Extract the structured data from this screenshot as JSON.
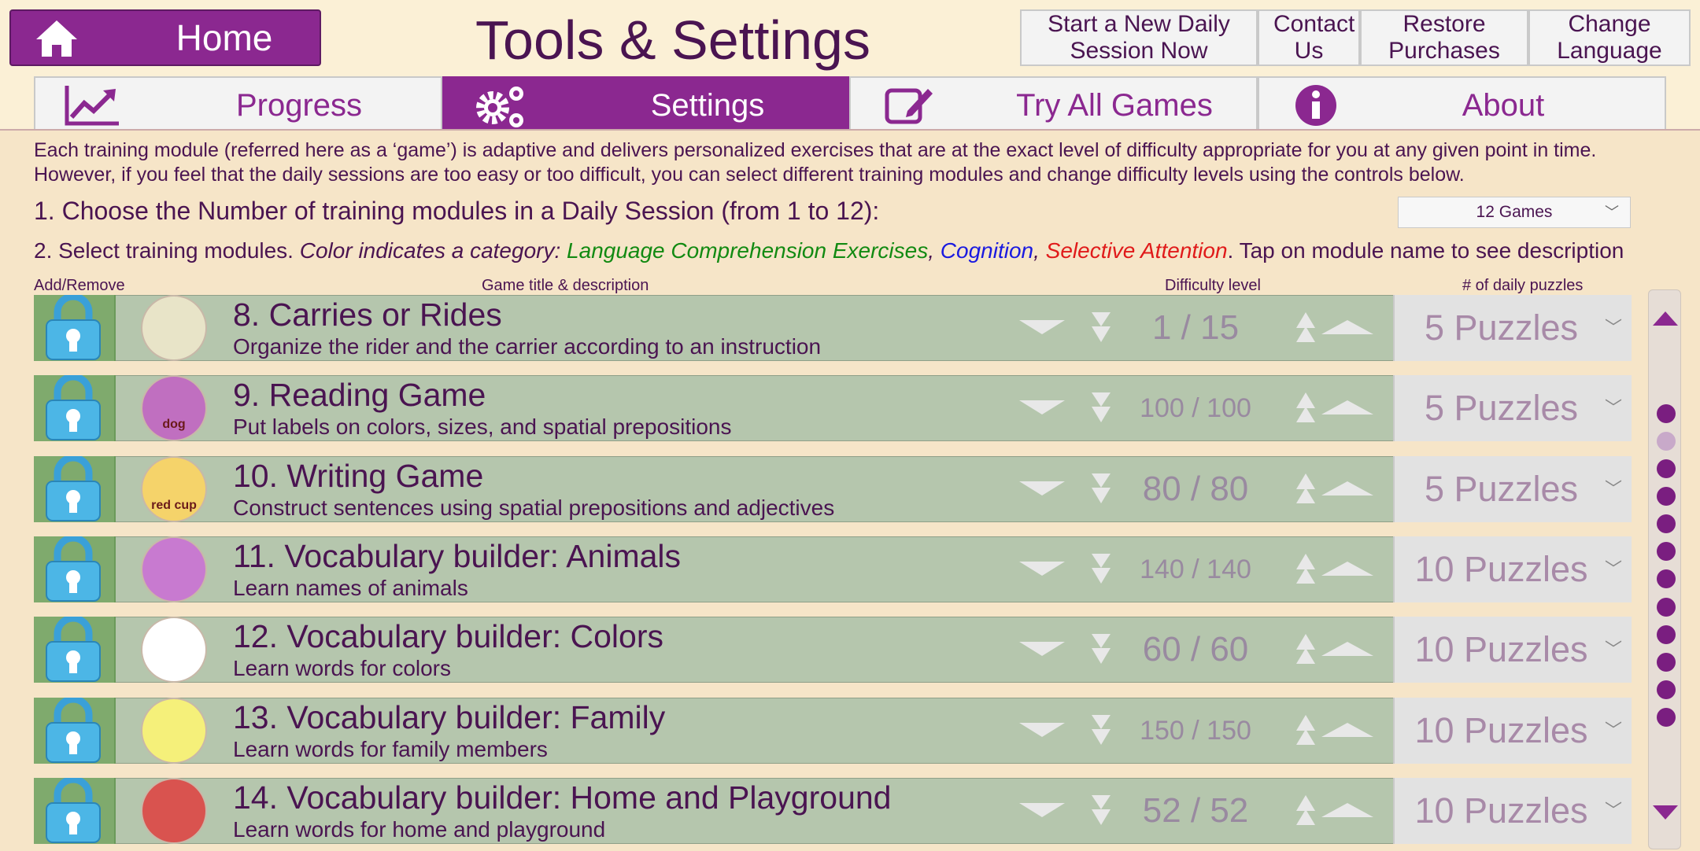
{
  "header": {
    "home_label": "Home",
    "title": "Tools & Settings",
    "buttons": [
      "Start a New Daily Session Now",
      "Contact Us",
      "Restore Purchases",
      "Change Language"
    ]
  },
  "tabs": [
    {
      "label": "Progress",
      "icon": "chart-line-icon",
      "active": false
    },
    {
      "label": "Settings",
      "icon": "gears-icon",
      "active": true
    },
    {
      "label": "Try All Games",
      "icon": "edit-icon",
      "active": false
    },
    {
      "label": "About",
      "icon": "info-icon",
      "active": false
    }
  ],
  "intro": {
    "line1": "Each training module (referred here as a ‘game’) is adaptive and delivers personalized exercises that are at the exact level of difficulty appropriate for you at any given point in time.",
    "line2": "However, if you feel that the daily sessions are too easy or too difficult, you can select different training modules and change difficulty levels using the controls below."
  },
  "step1": {
    "text": "1. Choose the Number of training modules in a Daily Session (from 1 to 12):",
    "selected": "12 Games"
  },
  "step2": {
    "prefix": "2. Select training modules.",
    "italic": "Color indicates a category:",
    "cat_language": "Language Comprehension Exercises",
    "sep1": ",",
    "cat_cognition": "Cognition",
    "sep2": ",",
    "cat_attention": "Selective Attention",
    "suffix": ". Tap on module name to see description"
  },
  "colors": {
    "language": "#128a12",
    "cognition": "#1a1ae0",
    "attention": "#e01a1a",
    "brand": "#8b2890"
  },
  "columns": {
    "add_remove": "Add/Remove",
    "title_desc": "Game title & description",
    "difficulty": "Difficulty level",
    "puzzles": "# of daily puzzles"
  },
  "modules": [
    {
      "title": "8. Carries or Rides",
      "desc": "Organize the rider and the carrier according to an instruction",
      "difficulty": "1 / 15",
      "puzzles": "5 Puzzles",
      "icon": "hippo-icon"
    },
    {
      "title": "9. Reading Game",
      "desc": "Put labels on colors, sizes, and spatial prepositions",
      "difficulty": "100 / 100",
      "puzzles": "5 Puzzles",
      "icon": "dog-icon",
      "icon_text": "dog"
    },
    {
      "title": "10. Writing Game",
      "desc": "Construct sentences using spatial prepositions and adjectives",
      "difficulty": "80 / 80",
      "puzzles": "5 Puzzles",
      "icon": "red-cup-icon",
      "icon_text": "red cup"
    },
    {
      "title": "11. Vocabulary builder: Animals",
      "desc": "Learn names of animals",
      "difficulty": "140 / 140",
      "puzzles": "10 Puzzles",
      "icon": "animals-icon"
    },
    {
      "title": "12. Vocabulary builder: Colors",
      "desc": "Learn words for colors",
      "difficulty": "60 / 60",
      "puzzles": "10 Puzzles",
      "icon": "colors-icon"
    },
    {
      "title": "13. Vocabulary builder: Family",
      "desc": "Learn words for family members",
      "difficulty": "150 / 150",
      "puzzles": "10 Puzzles",
      "icon": "family-icon"
    },
    {
      "title": "14. Vocabulary builder: Home and Playground",
      "desc": "Learn words for home and playground",
      "difficulty": "52 / 52",
      "puzzles": "10 Puzzles",
      "icon": "classroom-icon"
    }
  ]
}
